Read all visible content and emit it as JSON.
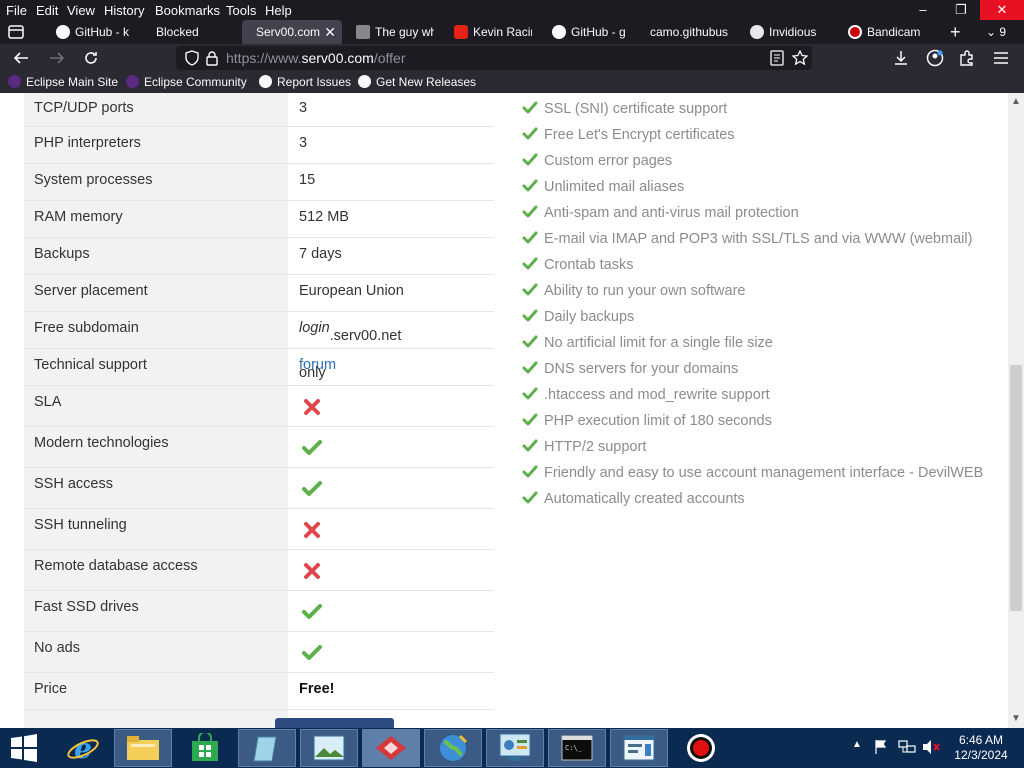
{
  "menubar": {
    "items": [
      "File",
      "Edit",
      "View",
      "History",
      "Bookmarks",
      "Tools",
      "Help"
    ]
  },
  "tabs": [
    {
      "label": "GitHub - k",
      "icon": "github-icon",
      "active": false
    },
    {
      "label": "Blocked",
      "icon": "",
      "active": false
    },
    {
      "label": "Serv00.com",
      "icon": "",
      "active": true
    },
    {
      "label": "The guy wh",
      "icon": "page-icon",
      "active": false
    },
    {
      "label": "Kevin Racin",
      "icon": "youtube-icon",
      "active": false
    },
    {
      "label": "GitHub - g",
      "icon": "github-icon",
      "active": false
    },
    {
      "label": "camo.githubus",
      "icon": "",
      "active": false
    },
    {
      "label": "Invidious",
      "icon": "invidious-icon",
      "active": false
    },
    {
      "label": "Bandicam",
      "icon": "record-icon",
      "active": false
    }
  ],
  "tab_count": "9",
  "address": {
    "prefix": "https://www.",
    "domain": "serv00.com",
    "path": "/offer"
  },
  "bookmarks": [
    {
      "label": "Eclipse Main Site",
      "icon": "eclipse-icon"
    },
    {
      "label": "Eclipse Community",
      "icon": "eclipse-icon"
    },
    {
      "label": "Report Issues",
      "icon": "github-icon"
    },
    {
      "label": "Get New Releases",
      "icon": "github-icon"
    }
  ],
  "specs": {
    "rows": [
      {
        "label": "TCP/UDP ports",
        "value": "3"
      },
      {
        "label": "PHP interpreters",
        "value": "3"
      },
      {
        "label": "System processes",
        "value": "15"
      },
      {
        "label": "RAM memory",
        "value": "512 MB"
      },
      {
        "label": "Backups",
        "value": "7 days"
      },
      {
        "label": "Server placement",
        "value": "European Union"
      },
      {
        "label": "Free subdomain",
        "value_italic": "login",
        "value_rest": ".serv00.net"
      },
      {
        "label": "Technical support",
        "value_prefix": "only ",
        "value_link": "forum"
      },
      {
        "label": "SLA",
        "status": "no"
      },
      {
        "label": "Modern technologies",
        "status": "yes"
      },
      {
        "label": "SSH access",
        "status": "yes"
      },
      {
        "label": "SSH tunneling",
        "status": "no"
      },
      {
        "label": "Remote database access",
        "status": "no"
      },
      {
        "label": "Fast SSD drives",
        "status": "yes"
      },
      {
        "label": "No ads",
        "status": "yes"
      },
      {
        "label": "Price",
        "value_bold": "Free!"
      }
    ]
  },
  "features": [
    "SSL (SNI) certificate support",
    "Free Let's Encrypt certificates",
    "Custom error pages",
    "Unlimited mail aliases",
    "Anti-spam and anti-virus mail protection",
    "E-mail via IMAP and POP3 with SSL/TLS and via WWW (webmail)",
    "Crontab tasks",
    "Ability to run your own software",
    "Daily backups",
    "No artificial limit for a single file size",
    "DNS servers for your domains",
    ".htaccess and mod_rewrite support",
    "PHP execution limit of 180 seconds",
    "HTTP/2 support",
    "Friendly and easy to use account management interface - DevilWEB",
    "Automatically created accounts"
  ],
  "colors": {
    "check": "#5bb04b",
    "cross": "#e0474c",
    "link": "#2a6fb5"
  },
  "taskbar": {
    "apps": [
      "start-icon",
      "internet-explorer-icon",
      "file-explorer-icon",
      "store-icon",
      "notepad-icon",
      "photos-icon",
      "red-app-icon",
      "browser-globe-icon",
      "control-panel-icon",
      "command-prompt-icon",
      "task-icon",
      "record-icon"
    ],
    "time": "6:46 AM",
    "date": "12/3/2024"
  }
}
